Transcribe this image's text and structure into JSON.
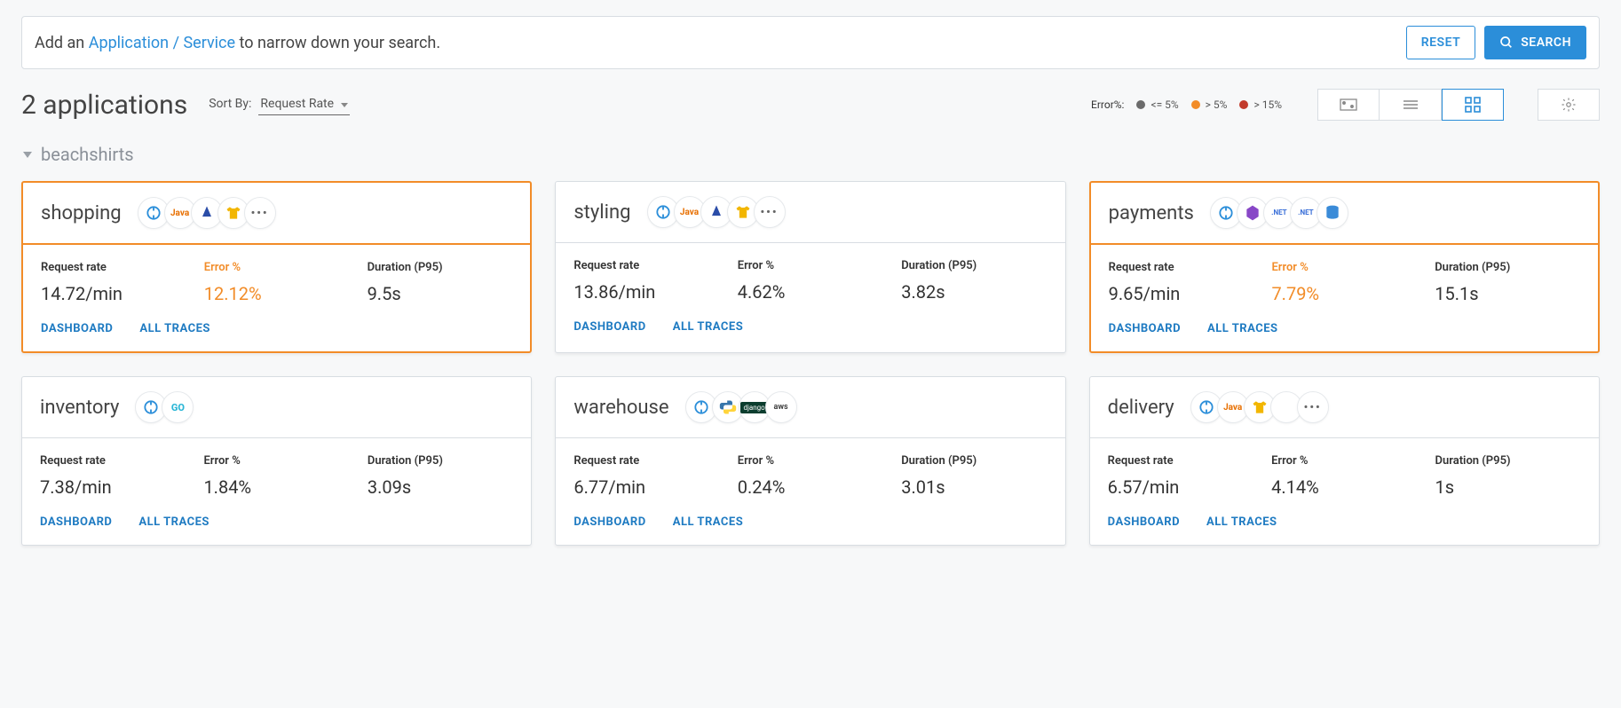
{
  "search": {
    "prefix": "Add an ",
    "link_text": "Application / Service",
    "suffix": " to narrow down your search."
  },
  "buttons": {
    "reset": "RESET",
    "search": "SEARCH"
  },
  "header": {
    "count_title": "2 applications",
    "sort_label": "Sort By:",
    "sort_value": "Request Rate"
  },
  "legend": {
    "label": "Error%:",
    "low": "<= 5%",
    "mid": "> 5%",
    "high": "> 15%"
  },
  "group": {
    "name": "beachshirts"
  },
  "metric_labels": {
    "rate": "Request rate",
    "error": "Error %",
    "duration": "Duration (P95)"
  },
  "card_links": {
    "dashboard": "DASHBOARD",
    "traces": "ALL TRACES"
  },
  "cards": [
    {
      "name": "shopping",
      "warn": true,
      "icons": [
        "ot",
        "java",
        "hat",
        "shirt",
        "more"
      ],
      "rate": "14.72/min",
      "error": "12.12%",
      "error_warn": true,
      "duration": "9.5s"
    },
    {
      "name": "styling",
      "warn": false,
      "icons": [
        "ot",
        "java",
        "hat",
        "shirt",
        "more"
      ],
      "rate": "13.86/min",
      "error": "4.62%",
      "error_warn": false,
      "duration": "3.82s"
    },
    {
      "name": "payments",
      "warn": true,
      "icons": [
        "ot",
        "hex",
        "net",
        "net",
        "db"
      ],
      "rate": "9.65/min",
      "error": "7.79%",
      "error_warn": true,
      "duration": "15.1s"
    },
    {
      "name": "inventory",
      "warn": false,
      "icons": [
        "ot",
        "go"
      ],
      "rate": "7.38/min",
      "error": "1.84%",
      "error_warn": false,
      "duration": "3.09s"
    },
    {
      "name": "warehouse",
      "warn": false,
      "icons": [
        "ot",
        "py",
        "dj",
        "aws"
      ],
      "rate": "6.77/min",
      "error": "0.24%",
      "error_warn": false,
      "duration": "3.01s"
    },
    {
      "name": "delivery",
      "warn": false,
      "icons": [
        "ot",
        "java",
        "shirt",
        "blank",
        "more"
      ],
      "rate": "6.57/min",
      "error": "4.14%",
      "error_warn": false,
      "duration": "1s"
    }
  ]
}
